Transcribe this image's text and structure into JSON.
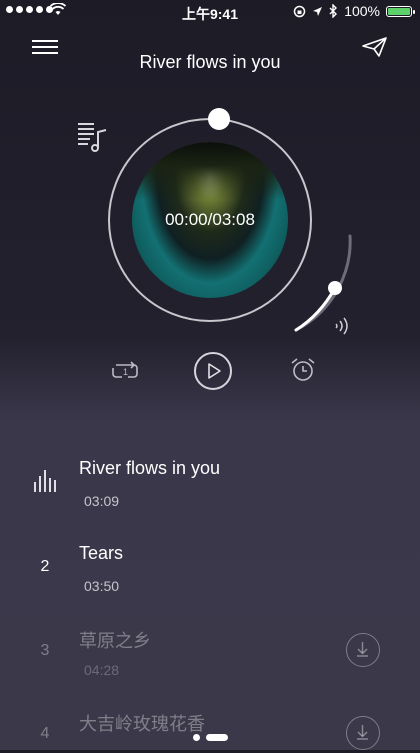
{
  "status": {
    "time": "上午9:41",
    "battery": "100%"
  },
  "header": {
    "title": "River flows in you"
  },
  "player": {
    "elapsed_total": "00:00/03:08",
    "progress": 0.0,
    "volume": 0.5
  },
  "songs": [
    {
      "index": "",
      "name": "River flows in you",
      "duration": "03:09",
      "state": "playing"
    },
    {
      "index": "2",
      "name": "Tears",
      "duration": "03:50",
      "state": "available"
    },
    {
      "index": "3",
      "name": "草原之乡",
      "duration": "04:28",
      "state": "download"
    },
    {
      "index": "4",
      "name": "大吉岭玫瑰花香",
      "duration": "",
      "state": "download"
    }
  ],
  "icons": {
    "menu": "menu-icon",
    "share": "paper-plane-icon",
    "playlist": "playlist-music-icon",
    "speaker": "speaker-icon",
    "repeat": "repeat-one-icon",
    "play": "play-icon",
    "alarm": "alarm-clock-icon",
    "now_playing": "equalizer-bars-icon",
    "download": "download-icon"
  },
  "pager": {
    "pages": 2,
    "current": 1
  },
  "colors": {
    "accent": "#ffffff",
    "battery": "#5dd16a",
    "background": "#1d1b26"
  }
}
